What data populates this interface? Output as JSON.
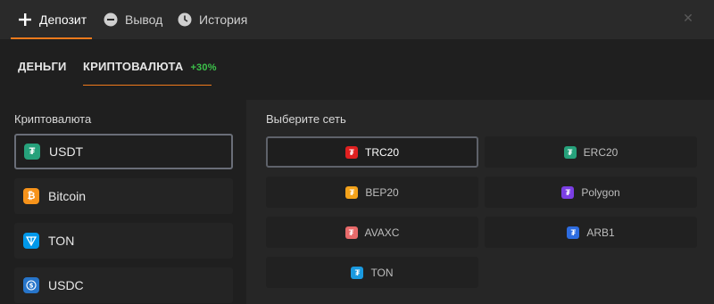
{
  "header": {
    "tabs": [
      {
        "label": "Депозит",
        "icon": "plus-icon",
        "active": true
      },
      {
        "label": "Вывод",
        "icon": "minus-circle-icon",
        "active": false
      },
      {
        "label": "История",
        "icon": "clock-icon",
        "active": false
      }
    ],
    "close_icon": "close-icon",
    "accent": "#f07a1c"
  },
  "subtabs": [
    {
      "label": "ДЕНЬГИ"
    },
    {
      "label": "КРИПТОВАЛЮТА",
      "bonus": "+30%"
    }
  ],
  "crypto": {
    "label": "Криптовалюта",
    "items": [
      {
        "label": "USDT",
        "icon": "tether-icon",
        "color": "#26a17b",
        "selected": true
      },
      {
        "label": "Bitcoin",
        "icon": "bitcoin-icon",
        "color": "#f7931a",
        "selected": false
      },
      {
        "label": "TON",
        "icon": "ton-icon",
        "color": "#0098ea",
        "selected": false
      },
      {
        "label": "USDC",
        "icon": "usdc-icon",
        "color": "#2775ca",
        "selected": false
      }
    ]
  },
  "network": {
    "label": "Выберите сеть",
    "items": [
      {
        "label": "TRC20",
        "icon": "tether-trc20-icon",
        "color": "#e02020",
        "selected": true
      },
      {
        "label": "ERC20",
        "icon": "tether-erc20-icon",
        "color": "#26a17b",
        "selected": false
      },
      {
        "label": "BEP20",
        "icon": "tether-bep20-icon",
        "color": "#f3a21a",
        "selected": false
      },
      {
        "label": "Polygon",
        "icon": "tether-polygon-icon",
        "color": "#7b3fe4",
        "selected": false
      },
      {
        "label": "AVAXC",
        "icon": "tether-avaxc-icon",
        "color": "#e86a6a",
        "selected": false
      },
      {
        "label": "ARB1",
        "icon": "tether-arb1-icon",
        "color": "#2d6ce0",
        "selected": false
      },
      {
        "label": "TON",
        "icon": "tether-ton-icon",
        "color": "#1a9ae0",
        "selected": false
      }
    ]
  }
}
